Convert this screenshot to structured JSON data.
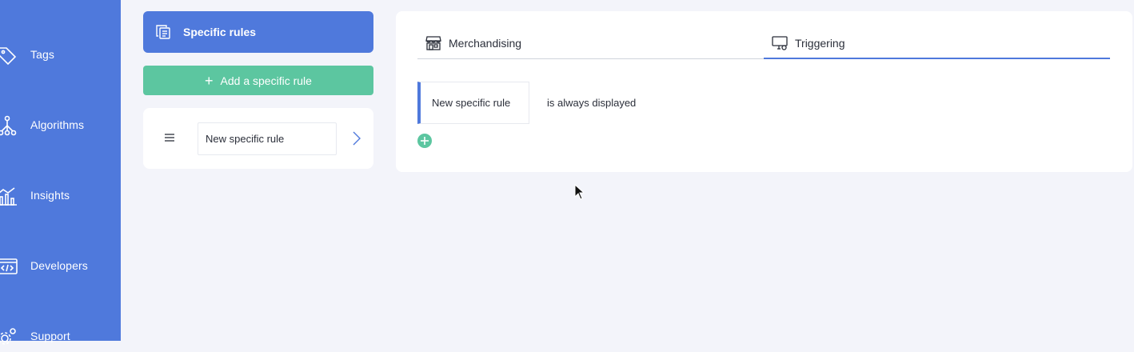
{
  "sidebar": {
    "items": [
      {
        "label": "Tags",
        "icon": "tag-icon"
      },
      {
        "label": "Algorithms",
        "icon": "algorithm-tree-icon"
      },
      {
        "label": "Insights",
        "icon": "chart-icon"
      },
      {
        "label": "Developers",
        "icon": "code-icon"
      },
      {
        "label": "Support",
        "icon": "gear-icon"
      }
    ]
  },
  "rules_panel": {
    "title": "Specific rules",
    "add_button_label": "Add a specific rule",
    "rule_item": {
      "name": "New specific rule"
    }
  },
  "editor": {
    "tabs": [
      {
        "label": "Merchandising",
        "icon": "store-icon",
        "active": false
      },
      {
        "label": "Triggering",
        "icon": "monitor-icon",
        "active": true
      }
    ],
    "trigger": {
      "rule_name": "New specific rule",
      "description": "is always displayed"
    }
  },
  "colors": {
    "primary": "#4f79dc",
    "accent": "#5cc6a0",
    "background": "#f3f4fa"
  }
}
